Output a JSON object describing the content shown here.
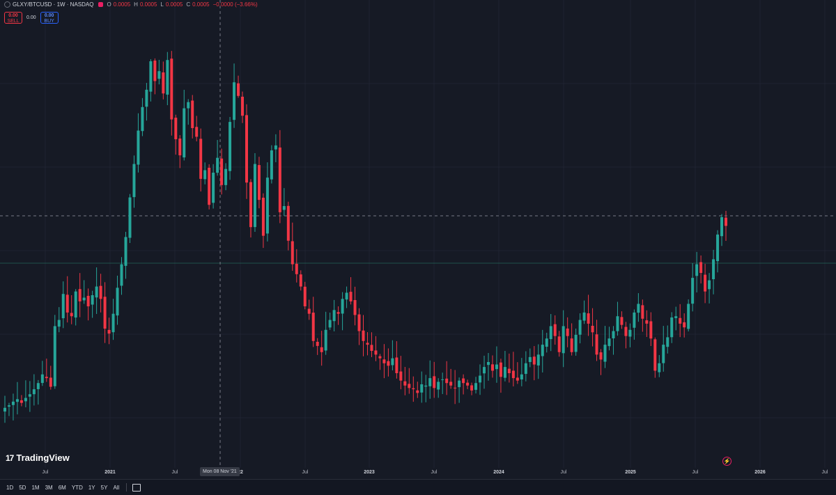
{
  "header": {
    "symbol": "GLXY/BTCUSD · 1W · NASDAQ",
    "open_label": "O",
    "open": "0.0005",
    "high_label": "H",
    "high": "0.0005",
    "low_label": "L",
    "low": "0.0005",
    "close_label": "C",
    "close": "0.0005",
    "change": "−0.0000 (−3.66%)"
  },
  "trade": {
    "sell_price": "0.00",
    "sell_label": "SELL",
    "spread": "0.00",
    "buy_price": "0.00",
    "buy_label": "BUY"
  },
  "brand": {
    "mark": "17",
    "name": "TradingView"
  },
  "crosshair_label": "Mon 08 Nov '21",
  "x_axis_labels": [
    {
      "text": "Jul",
      "year": false
    },
    {
      "text": "2021",
      "year": true
    },
    {
      "text": "Jul",
      "year": false
    },
    {
      "text": "22",
      "year": true
    },
    {
      "text": "Jul",
      "year": false
    },
    {
      "text": "2023",
      "year": true
    },
    {
      "text": "Jul",
      "year": false
    },
    {
      "text": "2024",
      "year": true
    },
    {
      "text": "Jul",
      "year": false
    },
    {
      "text": "2025",
      "year": true
    },
    {
      "text": "Jul",
      "year": false
    },
    {
      "text": "2026",
      "year": true
    },
    {
      "text": "Jul",
      "year": false
    }
  ],
  "ranges": [
    "1D",
    "5D",
    "1M",
    "3M",
    "6M",
    "YTD",
    "1Y",
    "5Y",
    "All"
  ],
  "icons": {
    "calendar": "calendar-range-icon",
    "bolt": "lightning-icon",
    "visibility": "eye-icon"
  },
  "colors": {
    "up": "#26a69a",
    "down": "#f23645",
    "background": "#161a25",
    "grid": "#1f2331"
  },
  "chart_data": {
    "type": "candlestick",
    "interval": "1W",
    "title": "GLXY/BTCUSD · 1W · NASDAQ",
    "x_start": "2020-05",
    "x_end": "2025-09",
    "y_scale": "relative (no price axis shown)",
    "series": [
      {
        "name": "GLXY/BTCUSD",
        "shape": "approx weekly closes (relative units)",
        "values": [
          5.8,
          6.0,
          6.3,
          6.5,
          6.2,
          6.6,
          6.9,
          7.3,
          7.8,
          8.5,
          8.2,
          7.5,
          12.4,
          12.9,
          15.0,
          13.5,
          13.2,
          15.2,
          14.4,
          14.7,
          14.0,
          14.9,
          15.6,
          14.6,
          12.2,
          11.8,
          13.4,
          15.5,
          17.4,
          19.6,
          22.8,
          25.5,
          28.2,
          30.1,
          31.5,
          33.8,
          32.2,
          33.0,
          31.2,
          33.9,
          29.1,
          27.5,
          26.2,
          30.0,
          30.5,
          28.4,
          27.7,
          24.3,
          25.0,
          22.2,
          24.8,
          26.0,
          23.8,
          25.1,
          28.9,
          32.1,
          31.0,
          29.4,
          24.0,
          20.4,
          25.5,
          22.6,
          19.7,
          24.4,
          26.6,
          27.0,
          21.6,
          22.1,
          19.3,
          17.4,
          16.6,
          15.6,
          14.0,
          13.4,
          11.2,
          10.8,
          10.3,
          12.1,
          12.9,
          13.7,
          13.4,
          14.6,
          15.1,
          14.4,
          13.3,
          12.0,
          11.2,
          10.9,
          10.4,
          10.1,
          9.8,
          9.4,
          9.2,
          9.8,
          8.6,
          8.0,
          7.6,
          7.4,
          7.3,
          7.0,
          7.7,
          7.6,
          8.2,
          7.4,
          7.9,
          8.1,
          7.8,
          7.6,
          7.4,
          8.0,
          7.8,
          7.6,
          7.2,
          7.8,
          8.4,
          9.1,
          9.5,
          8.8,
          9.3,
          8.3,
          9.1,
          8.6,
          8.2,
          8.0,
          8.5,
          9.4,
          9.9,
          9.3,
          10.1,
          10.9,
          11.4,
          12.4,
          11.6,
          10.3,
          12.4,
          11.6,
          10.3,
          11.7,
          12.9,
          13.5,
          12.6,
          11.9,
          10.1,
          9.7,
          10.9,
          11.4,
          12.0,
          13.2,
          12.5,
          11.6,
          12.1,
          13.5,
          14.2,
          13.0,
          12.6,
          11.4,
          8.8,
          9.4,
          10.9,
          11.5,
          13.1,
          13.2,
          12.6,
          12.3,
          14.2,
          16.3,
          17.4,
          16.7,
          15.2,
          16.1,
          17.8,
          19.8,
          21.2,
          20.5
        ]
      }
    ]
  }
}
